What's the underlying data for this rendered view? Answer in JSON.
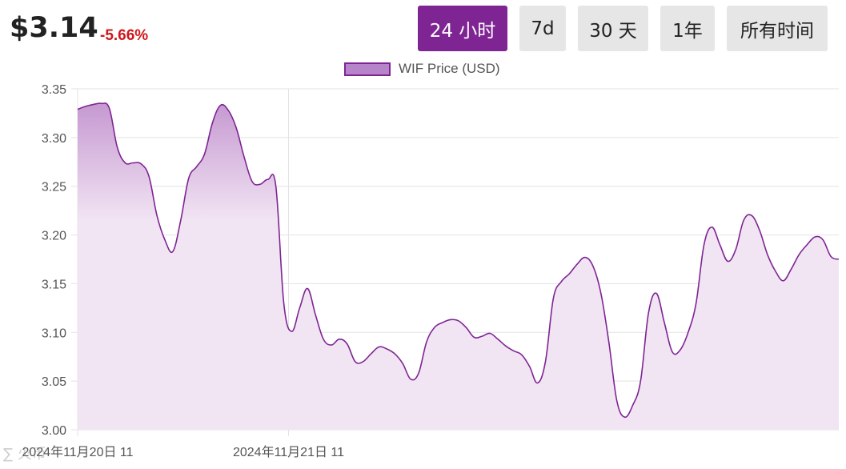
{
  "header": {
    "price": "$3.14",
    "change": "-5.66%"
  },
  "range_buttons": [
    {
      "label": "24 小时",
      "active": true
    },
    {
      "label": "7d",
      "active": false
    },
    {
      "label": "30 天",
      "active": false
    },
    {
      "label": "1年",
      "active": false
    },
    {
      "label": "所有时间",
      "active": false
    }
  ],
  "legend": {
    "label": "WIF Price (USD)"
  },
  "colors": {
    "accent": "#7e2593",
    "line": "#7e2593",
    "fill_light": "#f1e4f3",
    "fill_dark": "#c89fd2",
    "change_negative": "#d0161b",
    "button_bg": "#e6e6e6"
  },
  "watermark": {
    "text": "∑ 火币"
  },
  "chart_data": {
    "type": "area",
    "ylim": [
      3.0,
      3.35
    ],
    "yticks": [
      3.0,
      3.05,
      3.1,
      3.15,
      3.2,
      3.25,
      3.3,
      3.35
    ],
    "ytick_labels": [
      "3.00",
      "3.05",
      "3.10",
      "3.15",
      "3.20",
      "3.25",
      "3.30",
      "3.35"
    ],
    "xlim_hours": [
      0,
      24.0
    ],
    "xticks": [
      {
        "hour": 0,
        "label": "2024年11月20日 11"
      },
      {
        "hour": 6.65,
        "label": "2024年11月21日 11"
      }
    ],
    "grid": true,
    "legend_position": "top",
    "series": [
      {
        "name": "WIF Price (USD)",
        "x_hours": [
          0,
          0.25,
          0.5,
          0.75,
          1.0,
          1.25,
          1.5,
          1.75,
          2.0,
          2.25,
          2.5,
          2.75,
          3.0,
          3.25,
          3.5,
          3.75,
          4.0,
          4.25,
          4.5,
          4.75,
          5.0,
          5.25,
          5.5,
          5.75,
          6.0,
          6.25,
          6.5,
          6.75,
          7.0,
          7.25,
          7.5,
          7.75,
          8.0,
          8.25,
          8.5,
          8.75,
          9.0,
          9.25,
          9.5,
          9.75,
          10.0,
          10.25,
          10.5,
          10.75,
          11.0,
          11.25,
          11.5,
          11.75,
          12.0,
          12.25,
          12.5,
          12.75,
          13.0,
          13.25,
          13.5,
          13.75,
          14.0,
          14.25,
          14.5,
          14.75,
          15.0,
          15.25,
          15.5,
          15.75,
          16.0,
          16.25,
          16.5,
          16.75,
          17.0,
          17.25,
          17.5,
          17.75,
          18.0,
          18.25,
          18.5,
          18.75,
          19.0,
          19.25,
          19.5,
          19.75,
          20.0,
          20.25,
          20.5,
          20.75,
          21.0,
          21.25,
          21.5,
          21.75,
          22.0,
          22.25,
          22.5,
          22.75,
          23.0,
          23.25,
          23.5,
          23.75,
          24.0
        ],
        "values": [
          3.329,
          3.332,
          3.334,
          3.335,
          3.33,
          3.29,
          3.274,
          3.274,
          3.273,
          3.26,
          3.22,
          3.195,
          3.183,
          3.215,
          3.258,
          3.27,
          3.283,
          3.315,
          3.333,
          3.328,
          3.31,
          3.28,
          3.255,
          3.252,
          3.257,
          3.25,
          3.13,
          3.101,
          3.125,
          3.145,
          3.118,
          3.093,
          3.087,
          3.093,
          3.088,
          3.07,
          3.07,
          3.078,
          3.085,
          3.083,
          3.078,
          3.068,
          3.052,
          3.058,
          3.09,
          3.105,
          3.11,
          3.113,
          3.112,
          3.105,
          3.095,
          3.096,
          3.099,
          3.093,
          3.086,
          3.081,
          3.077,
          3.065,
          3.048,
          3.07,
          3.135,
          3.152,
          3.16,
          3.17,
          3.177,
          3.168,
          3.14,
          3.09,
          3.03,
          3.013,
          3.025,
          3.05,
          3.12,
          3.14,
          3.11,
          3.08,
          3.082,
          3.1,
          3.13,
          3.19,
          3.208,
          3.19,
          3.173,
          3.185,
          3.215,
          3.22,
          3.205,
          3.18,
          3.163,
          3.153,
          3.165,
          3.18,
          3.19,
          3.198,
          3.195,
          3.178,
          3.175
        ]
      }
    ],
    "highlight_range_hours": [
      0,
      6.65
    ]
  }
}
